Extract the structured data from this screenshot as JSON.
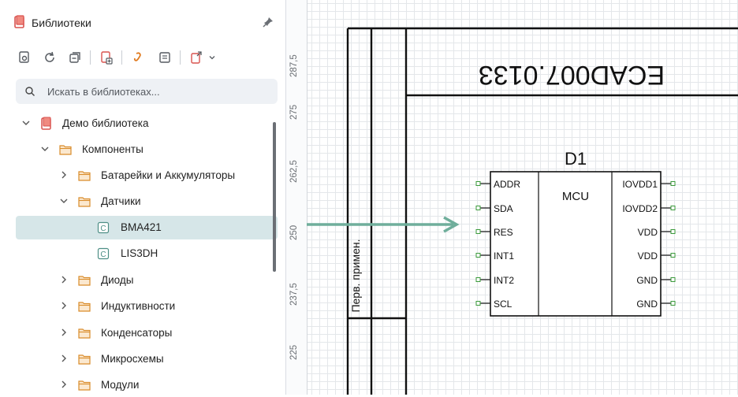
{
  "panel": {
    "title": "Библиотеки",
    "search_placeholder": "Искать в библиотеках..."
  },
  "tree": [
    {
      "label": "Демо библиотека",
      "type": "library",
      "expanded": true
    },
    {
      "label": "Компоненты",
      "type": "folder",
      "expanded": true
    },
    {
      "label": "Батарейки и Аккумуляторы",
      "type": "folder",
      "expanded": false
    },
    {
      "label": "Датчики",
      "type": "folder",
      "expanded": true
    },
    {
      "label": "BMA421",
      "type": "component",
      "selected": true
    },
    {
      "label": "LIS3DH",
      "type": "component"
    },
    {
      "label": "Диоды",
      "type": "folder",
      "expanded": false
    },
    {
      "label": "Индуктивности",
      "type": "folder",
      "expanded": false
    },
    {
      "label": "Конденсаторы",
      "type": "folder",
      "expanded": false
    },
    {
      "label": "Микросхемы",
      "type": "folder",
      "expanded": false
    },
    {
      "label": "Модули",
      "type": "folder",
      "expanded": false
    }
  ],
  "canvas": {
    "ruler_ticks": [
      "287,5",
      "275",
      "262,5",
      "250",
      "237,5",
      "225"
    ],
    "doc_code": "ECAD007.0133",
    "margin_label": "Перв. примен.",
    "component": {
      "ref": "D1",
      "body_label": "MCU",
      "left_pins": [
        "ADDR",
        "SDA",
        "RES",
        "INT1",
        "INT2",
        "SCL"
      ],
      "right_pins": [
        "IOVDD1",
        "IOVDD2",
        "VDD",
        "VDD",
        "GND",
        "GND"
      ]
    },
    "accent_color": "#6fae9b"
  }
}
